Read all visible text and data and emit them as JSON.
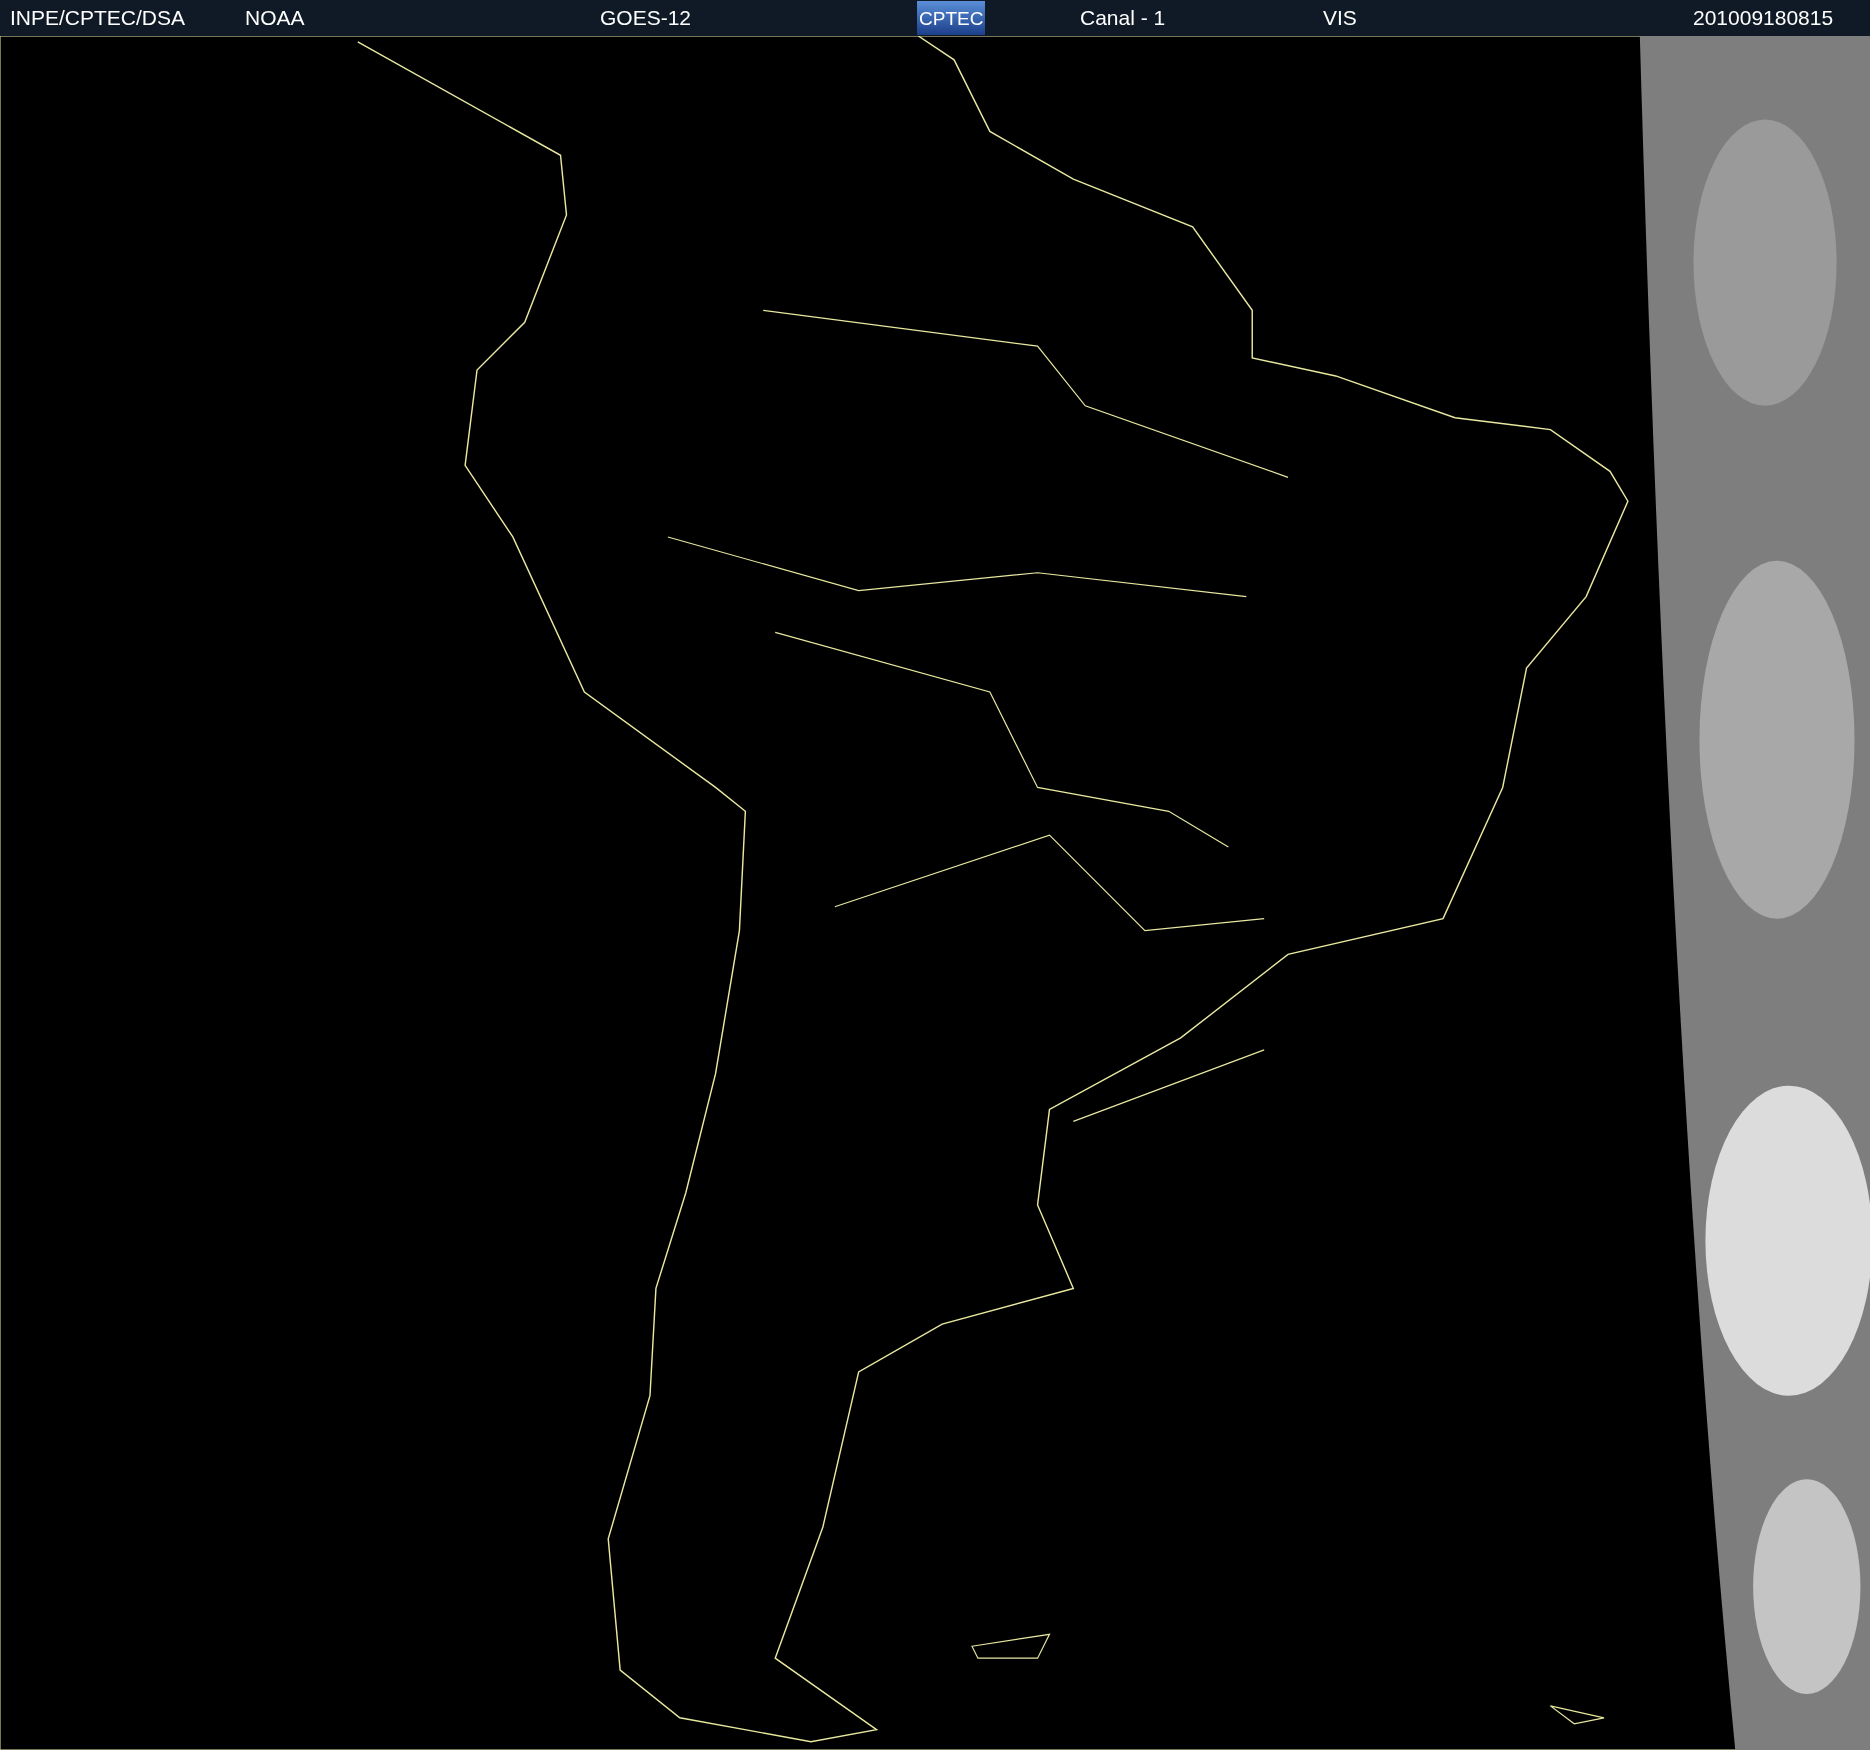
{
  "header": {
    "items": [
      {
        "kind": "text",
        "label": "INPE/CPTEC/DSA"
      },
      {
        "kind": "text",
        "label": "NOAA"
      },
      {
        "kind": "text",
        "label": "GOES-12"
      },
      {
        "kind": "logo",
        "label": "CPTEC"
      },
      {
        "kind": "text",
        "label": "Canal - 1"
      },
      {
        "kind": "text",
        "label": "VIS"
      },
      {
        "kind": "text",
        "label": "201009180815"
      }
    ]
  }
}
